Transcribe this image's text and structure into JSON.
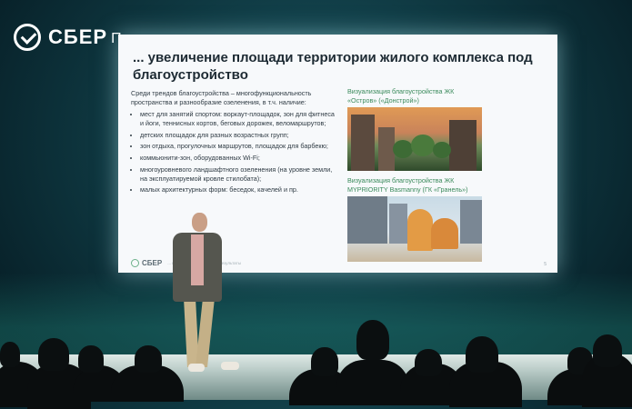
{
  "logo": {
    "wordmark": "СБЕР",
    "sub": "Про",
    "icon": "checkmark-circle-icon"
  },
  "slide": {
    "title": "... увеличение площади территории жилого комплекса под благоустройство",
    "intro": "Среди трендов благоустройства – многофункциональность пространства и разнообразие озеленения, в т.ч. наличие:",
    "bullets": [
      "мест для занятий спортом: воркаут-площадок, зон для фитнеса и йоги, теннисных кортов, беговых дорожек, веломаршрутов;",
      "детских площадок для разных возрастных групп;",
      "зон отдыха, прогулочных маршрутов, площадок для барбекю;",
      "коммьюнити-зон, оборудованных Wi-Fi;",
      "многоуровневого ландшафтного озеленения (на уровне земли, на эксплуатируемой кровле стилобата);",
      "малых архитектурных форм: беседок, качелей и пр."
    ],
    "caption1": "Визуализация благоустройства ЖК «Остров» («Донстрой»)",
    "caption2": "Визуализация благоустройства ЖК MYPRIORITY Basmanny (ГК «Гранель»)",
    "footer_word": "СБЕР",
    "footer_note": "... новые вызовы ... новые результаты",
    "page_number": "5"
  },
  "colors": {
    "accent": "#3a8a5b",
    "screen_bg": "#f7f9fb",
    "hall": "#0f3942"
  }
}
